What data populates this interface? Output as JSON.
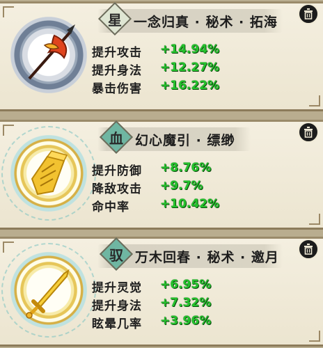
{
  "cards": [
    {
      "badge": "星",
      "title": "一念归真 · 秘术 · 拓海",
      "stats": [
        {
          "label": "提升攻击",
          "value": "+14.94%"
        },
        {
          "label": "提升身法",
          "value": "+12.27%"
        },
        {
          "label": "暴击伤害",
          "value": "+16.22%"
        }
      ],
      "icon": "flame-spear-icon"
    },
    {
      "badge": "血",
      "title": "幻心魔引 · 缥缈",
      "stats": [
        {
          "label": "提升防御",
          "value": "+8.76%"
        },
        {
          "label": "降敌攻击",
          "value": "+9.7%"
        },
        {
          "label": "命中率",
          "value": "+10.42%"
        }
      ],
      "icon": "golden-scroll-icon"
    },
    {
      "badge": "驭",
      "title": "万木回春 · 秘术 · 邀月",
      "stats": [
        {
          "label": "提升灵觉",
          "value": "+6.95%"
        },
        {
          "label": "提升身法",
          "value": "+7.32%"
        },
        {
          "label": "眩晕几率",
          "value": "+3.96%"
        }
      ],
      "icon": "golden-sword-icon"
    }
  ],
  "colors": {
    "stat_value": "#25c22d",
    "card_bg": "#f4efe0"
  }
}
